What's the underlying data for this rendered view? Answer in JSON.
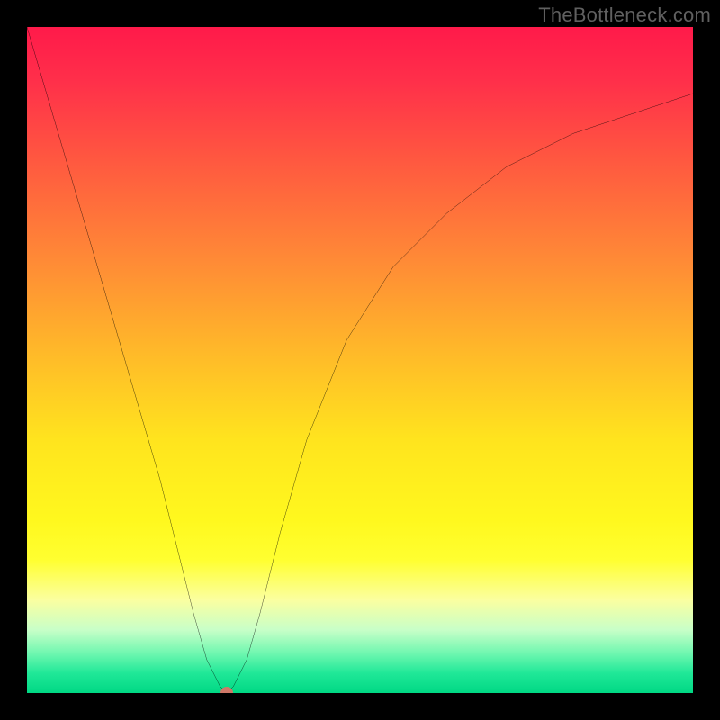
{
  "watermark": "TheBottleneck.com",
  "chart_data": {
    "type": "line",
    "title": "",
    "xlabel": "",
    "ylabel": "",
    "xlim": [
      0,
      100
    ],
    "ylim": [
      0,
      100
    ],
    "grid": false,
    "series": [
      {
        "name": "curve",
        "x": [
          0,
          5,
          10,
          15,
          20,
          25,
          27,
          29,
          30,
          31,
          33,
          35,
          38,
          42,
          48,
          55,
          63,
          72,
          82,
          100
        ],
        "values": [
          100,
          83,
          66,
          49,
          32,
          12,
          5,
          1,
          0,
          1,
          5,
          12,
          24,
          38,
          53,
          64,
          72,
          79,
          84,
          90
        ]
      }
    ],
    "annotations": [
      {
        "name": "marker",
        "x": 30,
        "y": 0,
        "color": "#cf7868"
      }
    ],
    "background_gradient": {
      "stops": [
        {
          "pos": 0.0,
          "color": "#ff1a4a"
        },
        {
          "pos": 0.08,
          "color": "#ff2f4a"
        },
        {
          "pos": 0.2,
          "color": "#ff5840"
        },
        {
          "pos": 0.35,
          "color": "#ff8a36"
        },
        {
          "pos": 0.5,
          "color": "#ffbd28"
        },
        {
          "pos": 0.62,
          "color": "#ffe41e"
        },
        {
          "pos": 0.74,
          "color": "#fff81e"
        },
        {
          "pos": 0.8,
          "color": "#ffff30"
        },
        {
          "pos": 0.86,
          "color": "#fbffa0"
        },
        {
          "pos": 0.905,
          "color": "#c8ffc8"
        },
        {
          "pos": 0.94,
          "color": "#70f7b0"
        },
        {
          "pos": 0.97,
          "color": "#20e898"
        },
        {
          "pos": 1.0,
          "color": "#00d884"
        }
      ]
    }
  }
}
